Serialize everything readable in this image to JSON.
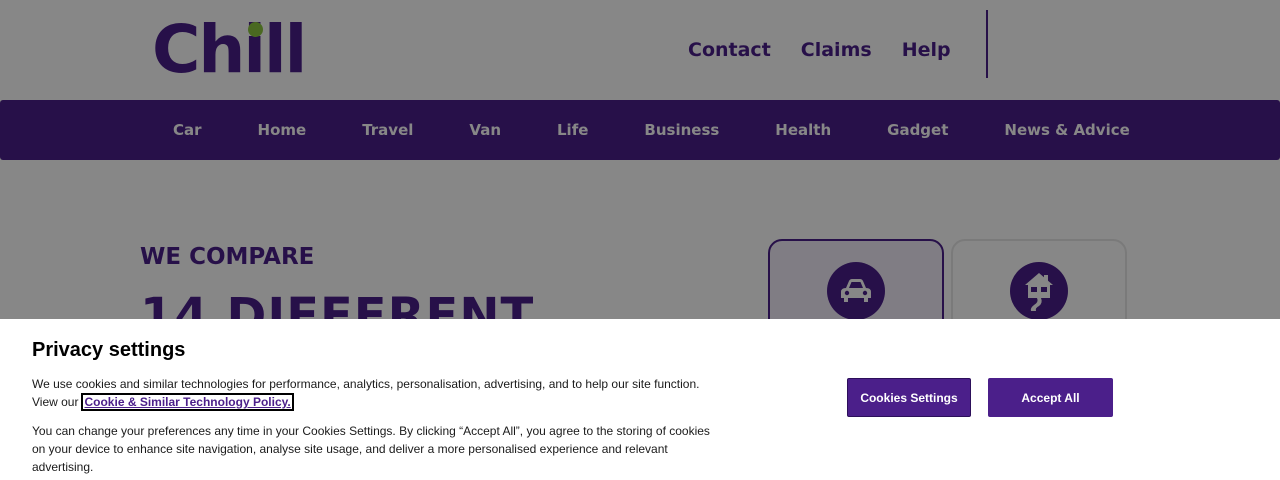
{
  "brand": {
    "logo_text": "Chill",
    "primary_color": "#4b1f8a",
    "accent_color": "#8cc63f"
  },
  "utility_nav": [
    {
      "label": "Contact"
    },
    {
      "label": "Claims"
    },
    {
      "label": "Help"
    }
  ],
  "main_nav": [
    {
      "label": "Car"
    },
    {
      "label": "Home"
    },
    {
      "label": "Travel"
    },
    {
      "label": "Van"
    },
    {
      "label": "Life"
    },
    {
      "label": "Business"
    },
    {
      "label": "Health"
    },
    {
      "label": "Gadget"
    },
    {
      "label": "News & Advice"
    }
  ],
  "hero": {
    "eyebrow": "WE COMPARE",
    "headline": "14 DIFFERENT"
  },
  "product_cards": [
    {
      "icon": "car-icon",
      "selected": true
    },
    {
      "icon": "home-icon",
      "selected": false
    }
  ],
  "cookie_banner": {
    "title": "Privacy settings",
    "text_1": "We use cookies and similar technologies for performance, analytics, personalisation, advertising, and to help our site function. View our",
    "policy_link": "Cookie & Similar Technology Policy.",
    "text_2": "You can change your preferences any time in your Cookies Settings. By clicking “Accept All”, you agree to the storing of cookies on your device to enhance site navigation, analyse site usage, and deliver a more personalised experience and relevant advertising.",
    "settings_button": "Cookies Settings",
    "accept_button": "Accept All"
  }
}
